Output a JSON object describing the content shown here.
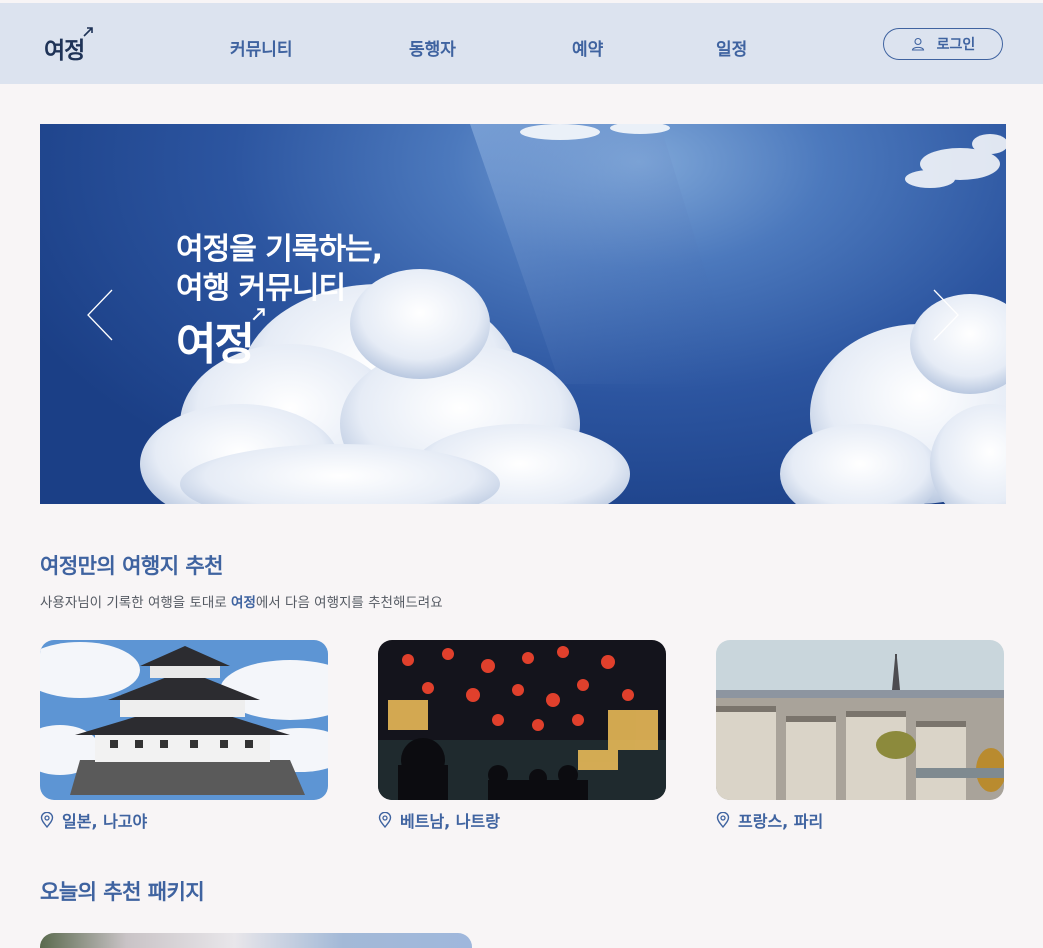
{
  "header": {
    "logo": "여정",
    "nav": [
      "커뮤니티",
      "동행자",
      "예약",
      "일정"
    ],
    "login_label": "로그인"
  },
  "hero": {
    "line1": "여정을 기록하는,",
    "line2": "여행 커뮤니티",
    "logo": "여정"
  },
  "recommend": {
    "title": "여정만의 여행지 추천",
    "subtitle_pre": "사용자님이 기록한 여행을 토대로 ",
    "subtitle_brand": "여정",
    "subtitle_post": "에서 다음 여행지를 추천해드려요",
    "cards": [
      {
        "label": "일본, 나고야"
      },
      {
        "label": "베트남, 나트랑"
      },
      {
        "label": "프랑스, 파리"
      }
    ]
  },
  "package": {
    "title": "오늘의 추천 패키지"
  },
  "colors": {
    "primary": "#3f63a0",
    "header_bg": "#dce3ef",
    "page_bg": "#f8f5f6"
  }
}
